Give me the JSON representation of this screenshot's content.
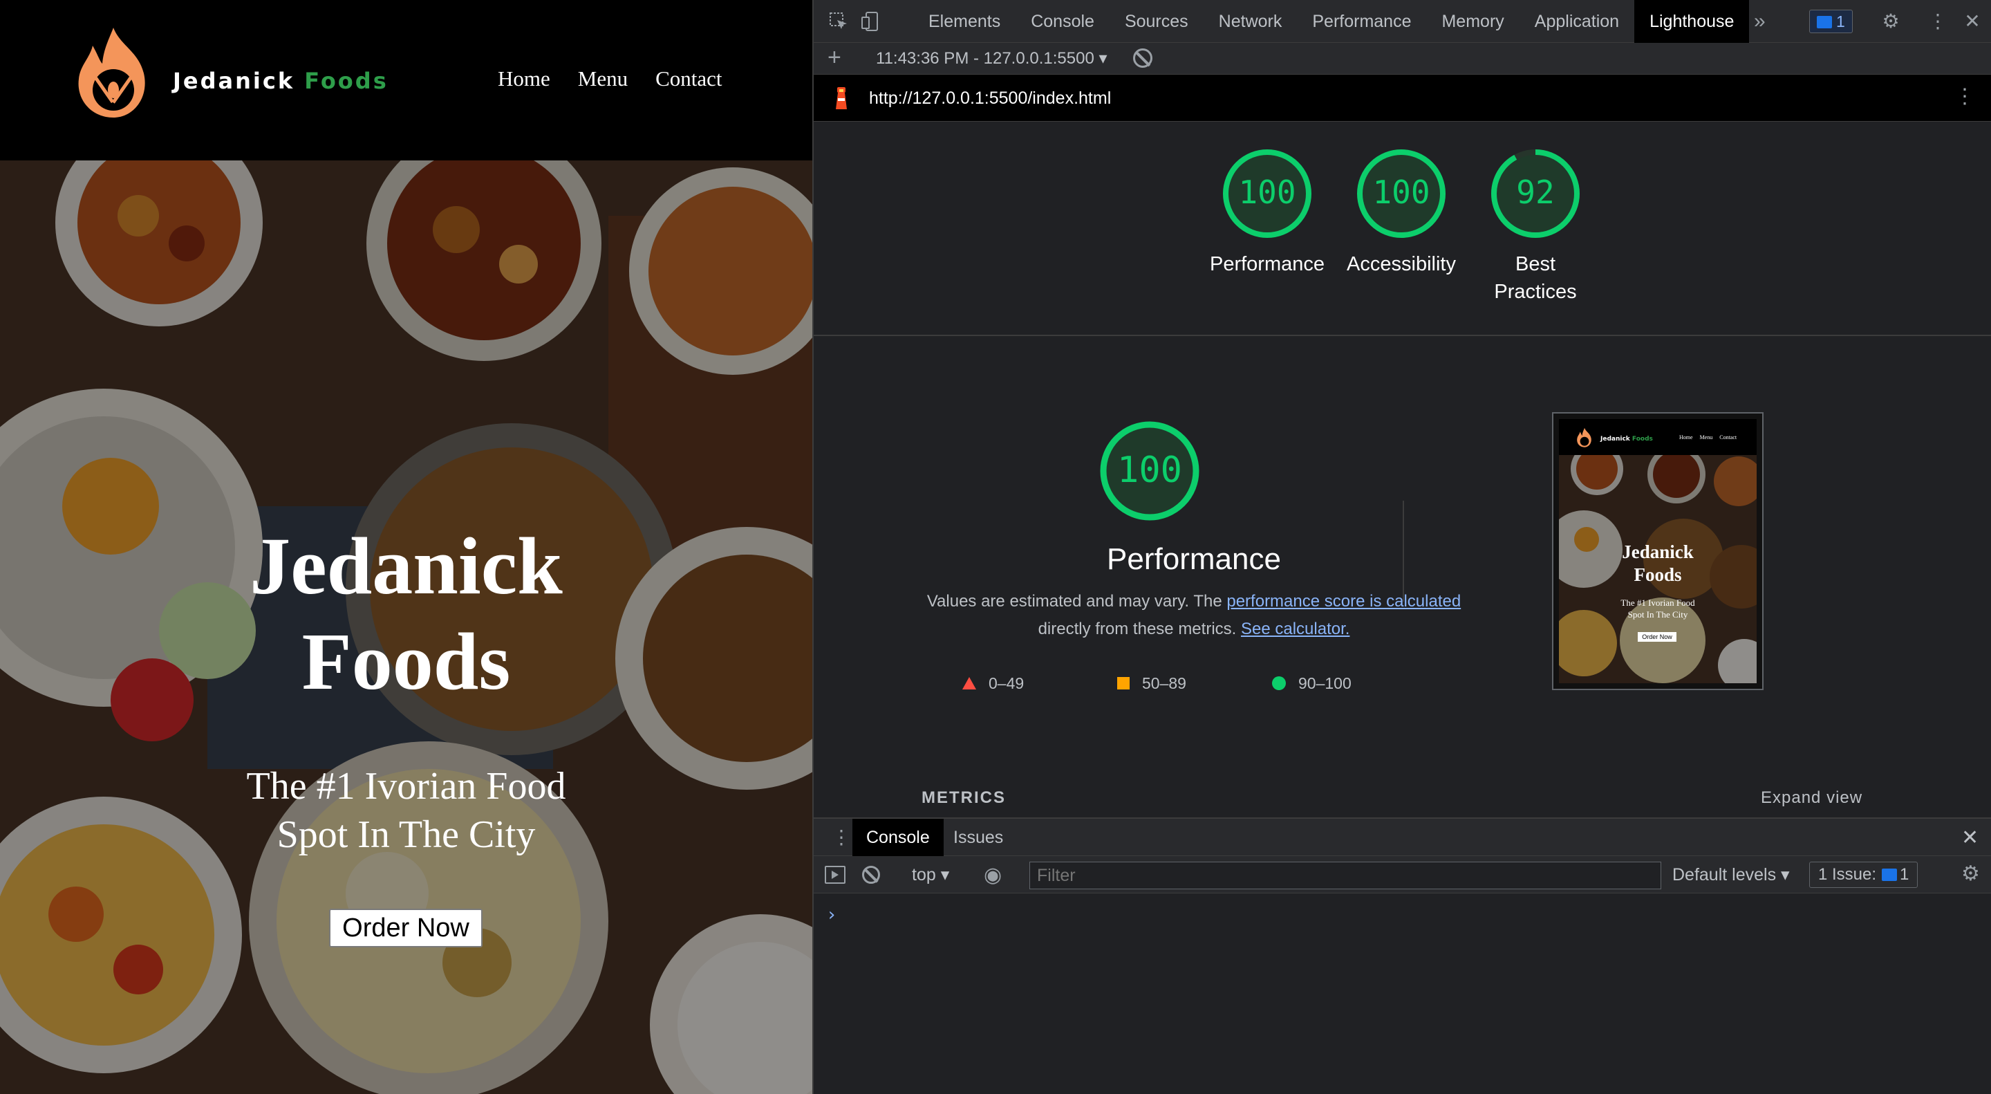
{
  "site": {
    "brand_name": "Jedanick",
    "brand_accent": "Foods",
    "nav": [
      "Home",
      "Menu",
      "Contact"
    ],
    "hero_title": [
      "Jedanick",
      "Foods"
    ],
    "hero_subtitle": [
      "The #1 Ivorian Food",
      "Spot In The City"
    ],
    "cta_label": "Order Now",
    "colors": {
      "logo_orange": "#f4955a",
      "accent_green": "#2e9e4a"
    }
  },
  "devtools": {
    "tabs": [
      "Elements",
      "Console",
      "Sources",
      "Network",
      "Performance",
      "Memory",
      "Application",
      "Lighthouse"
    ],
    "active_tab": "Lighthouse",
    "issues_count": "1",
    "lighthouse": {
      "run_label": "11:43:36 PM - 127.0.0.1:5500",
      "url": "http://127.0.0.1:5500/index.html",
      "scores": [
        {
          "name": "Performance",
          "value": 100
        },
        {
          "name": "Accessibility",
          "value": 100
        },
        {
          "name": "Best Practices",
          "value": 92
        }
      ],
      "best_practices_label": [
        "Best",
        "Practices"
      ],
      "detail": {
        "score": "100",
        "title": "Performance",
        "desc_prefix": "Values are estimated and may vary. The ",
        "link1": "performance score is calculated",
        "desc_mid": " directly from these metrics. ",
        "link2": "See calculator."
      },
      "legend": [
        "0–49",
        "50–89",
        "90–100"
      ],
      "legend_colors": {
        "fail": "#ff4e42",
        "average": "#ffa400",
        "pass": "#0cce6b"
      },
      "metrics_label": "METRICS",
      "expand_label": "Expand view",
      "thumb_nav": [
        "Home",
        "Menu",
        "Contact"
      ],
      "thumb_sub": [
        "The #1 Ivorian Food",
        "Spot In The City"
      ]
    },
    "drawer": {
      "tabs": [
        "Console",
        "Issues"
      ],
      "context": "top",
      "filter_placeholder": "Filter",
      "levels": "Default levels",
      "issues_label": "1 Issue:",
      "issues_count": "1",
      "prompt": "›"
    }
  }
}
